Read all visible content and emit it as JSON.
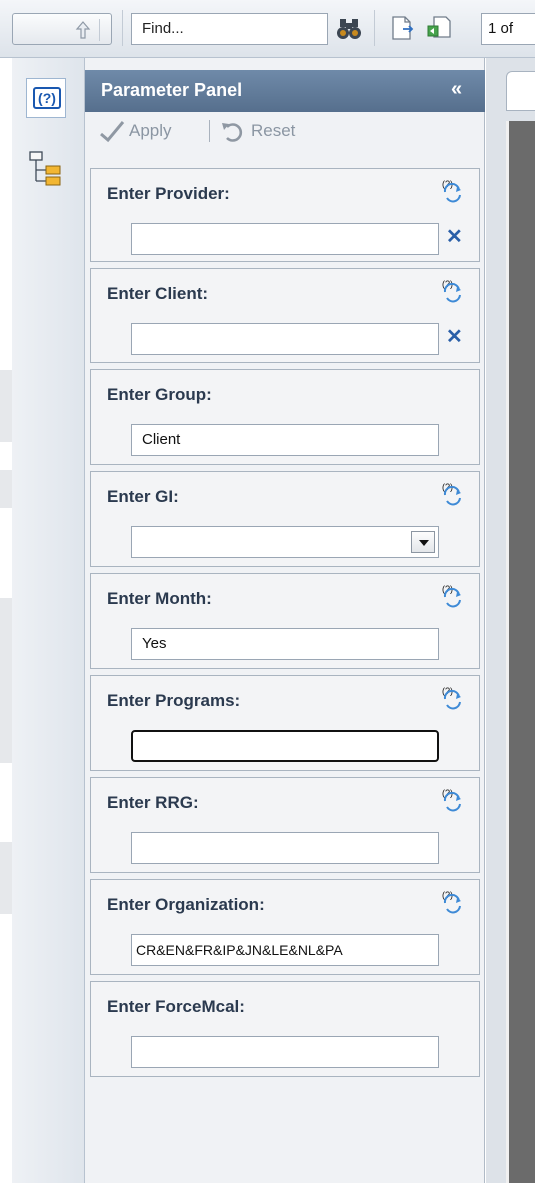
{
  "toolbar": {
    "find_placeholder": "Find...",
    "page_indicator": "1 of"
  },
  "panel": {
    "title": "Parameter Panel",
    "collapse_glyph": "«",
    "apply_label": "Apply",
    "reset_label": "Reset"
  },
  "parameters": [
    {
      "label": "Enter Provider:",
      "value": "",
      "has_help": true,
      "has_clear": true
    },
    {
      "label": "Enter Client:",
      "value": "",
      "has_help": true,
      "has_clear": true
    },
    {
      "label": "Enter Group:",
      "value": "Client",
      "has_help": false
    },
    {
      "label": "Enter GI:",
      "value": "",
      "has_help": true,
      "has_dropdown": true
    },
    {
      "label": "Enter Month:",
      "value": "Yes",
      "has_help": true
    },
    {
      "label": "Enter Programs:",
      "value": "",
      "has_help": true,
      "focused": true
    },
    {
      "label": "Enter RRG:",
      "value": "",
      "has_help": true
    },
    {
      "label": "Enter Organization:",
      "value": "CR&EN&FR&IP&JN&LE&NL&PA",
      "has_help": true
    },
    {
      "label": "Enter ForceMcal:",
      "value": "",
      "has_help": false
    }
  ],
  "icons": {
    "help": "help-icon",
    "tree": "tree-view-icon",
    "up": "up-arrow-icon",
    "find": "binoculars-icon",
    "clear": "clear-x-icon"
  },
  "colors": {
    "panel_header": "#6f8aa9",
    "label_text": "#2b3a4f",
    "clear_x": "#2a5fa8",
    "report_canvas": "#6b6b6b"
  }
}
